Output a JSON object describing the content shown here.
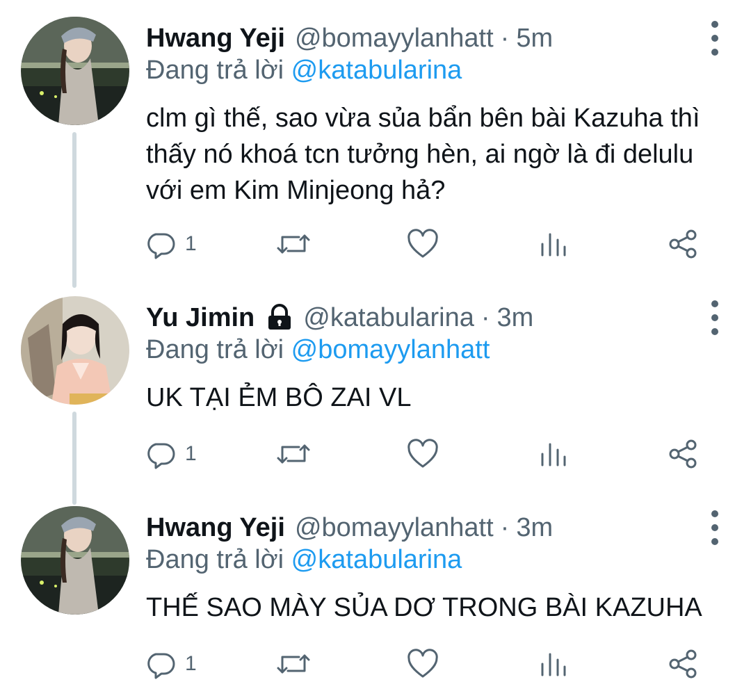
{
  "tweets": [
    {
      "author_name": "Hwang Yeji",
      "handle": "@bomayylanhatt",
      "separator": "·",
      "time": "5m",
      "replying_prefix": "Đang trả lời",
      "replying_to": "@katabularina",
      "body": "clm gì thế, sao vừa sủa bẩn bên bài Kazuha thì thấy nó khoá tcn tưởng hèn, ai ngờ là đi delulu với em Kim Minjeong hả?",
      "reply_count": "1",
      "protected": false
    },
    {
      "author_name": "Yu Jimin",
      "handle": "@katabularina",
      "separator": "·",
      "time": "3m",
      "replying_prefix": "Đang trả lời",
      "replying_to": "@bomayylanhatt",
      "body": "UK TẠI ẺM BÔ ZAI VL",
      "reply_count": "1",
      "protected": true
    },
    {
      "author_name": "Hwang Yeji",
      "handle": "@bomayylanhatt",
      "separator": "·",
      "time": "3m",
      "replying_prefix": "Đang trả lời",
      "replying_to": "@katabularina",
      "body": "THẾ SAO MÀY SỦA DƠ TRONG BÀI KAZUHA",
      "reply_count": "1",
      "protected": false
    }
  ],
  "icons": {
    "reply": "reply-icon",
    "retweet": "retweet-icon",
    "like": "heart-icon",
    "views": "analytics-icon",
    "share": "share-icon",
    "more": "more-vertical-icon",
    "lock": "lock-icon"
  },
  "colors": {
    "text": "#0f1419",
    "secondary": "#536471",
    "link": "#1d9bf0",
    "thread_line": "#cfd9de"
  }
}
